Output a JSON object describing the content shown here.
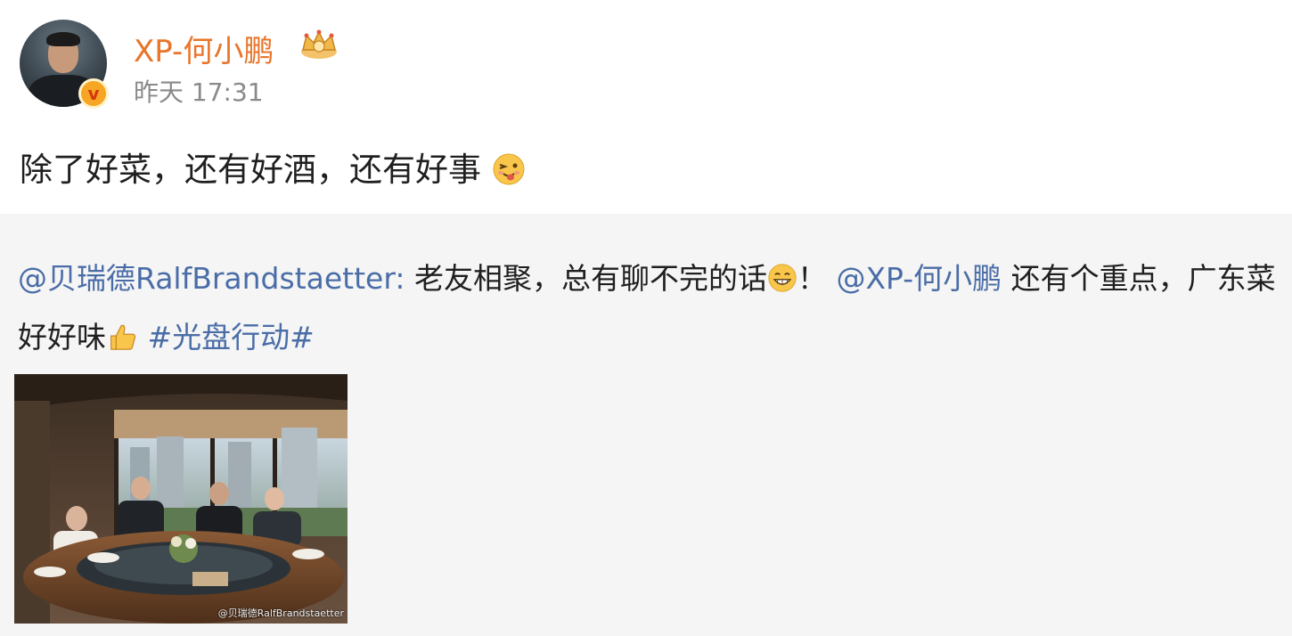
{
  "post": {
    "author": "XP-何小鹏",
    "timestamp": "昨天 17:31",
    "text": "除了好菜，还有好酒，还有好事",
    "text_emoji": "tongue-wink-emoji"
  },
  "retweet": {
    "author_mention": "@贝瑞德RalfBrandstaetter",
    "separator": ":",
    "text_part1": " 老友相聚，总有聊不完的话",
    "emoji1": "grin-emoji",
    "text_part2": "！",
    "mention2": "@XP-何小鹏",
    "text_part3": " 还有个重点，广东菜好好味",
    "emoji2": "thumbs-up-emoji",
    "hashtag": "#光盘行动#",
    "photo_watermark": "@贝瑞德RalfBrandstaetter"
  },
  "colors": {
    "username": "#e8752a",
    "link": "#4a6da7",
    "timestamp": "#8a8a8a",
    "retweet_bg": "#f5f5f5",
    "verified_badge": "#f6a623"
  }
}
